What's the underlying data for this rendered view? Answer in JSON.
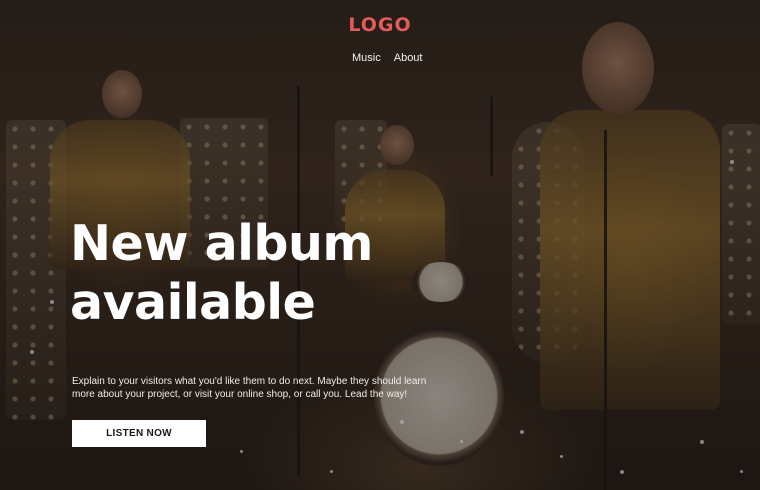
{
  "header": {
    "logo": "LOGO",
    "logo_color": "#e25c5c",
    "nav": [
      "Music",
      "About"
    ]
  },
  "hero": {
    "headline_line1": "New album",
    "headline_line2": "available",
    "description": "Explain to your visitors what you'd like them to do next. Maybe they should learn more about your project, or visit your online shop, or call you. Lead the way!",
    "cta_label": "LISTEN NOW",
    "background": "photo-of-band-performing-on-stage"
  }
}
